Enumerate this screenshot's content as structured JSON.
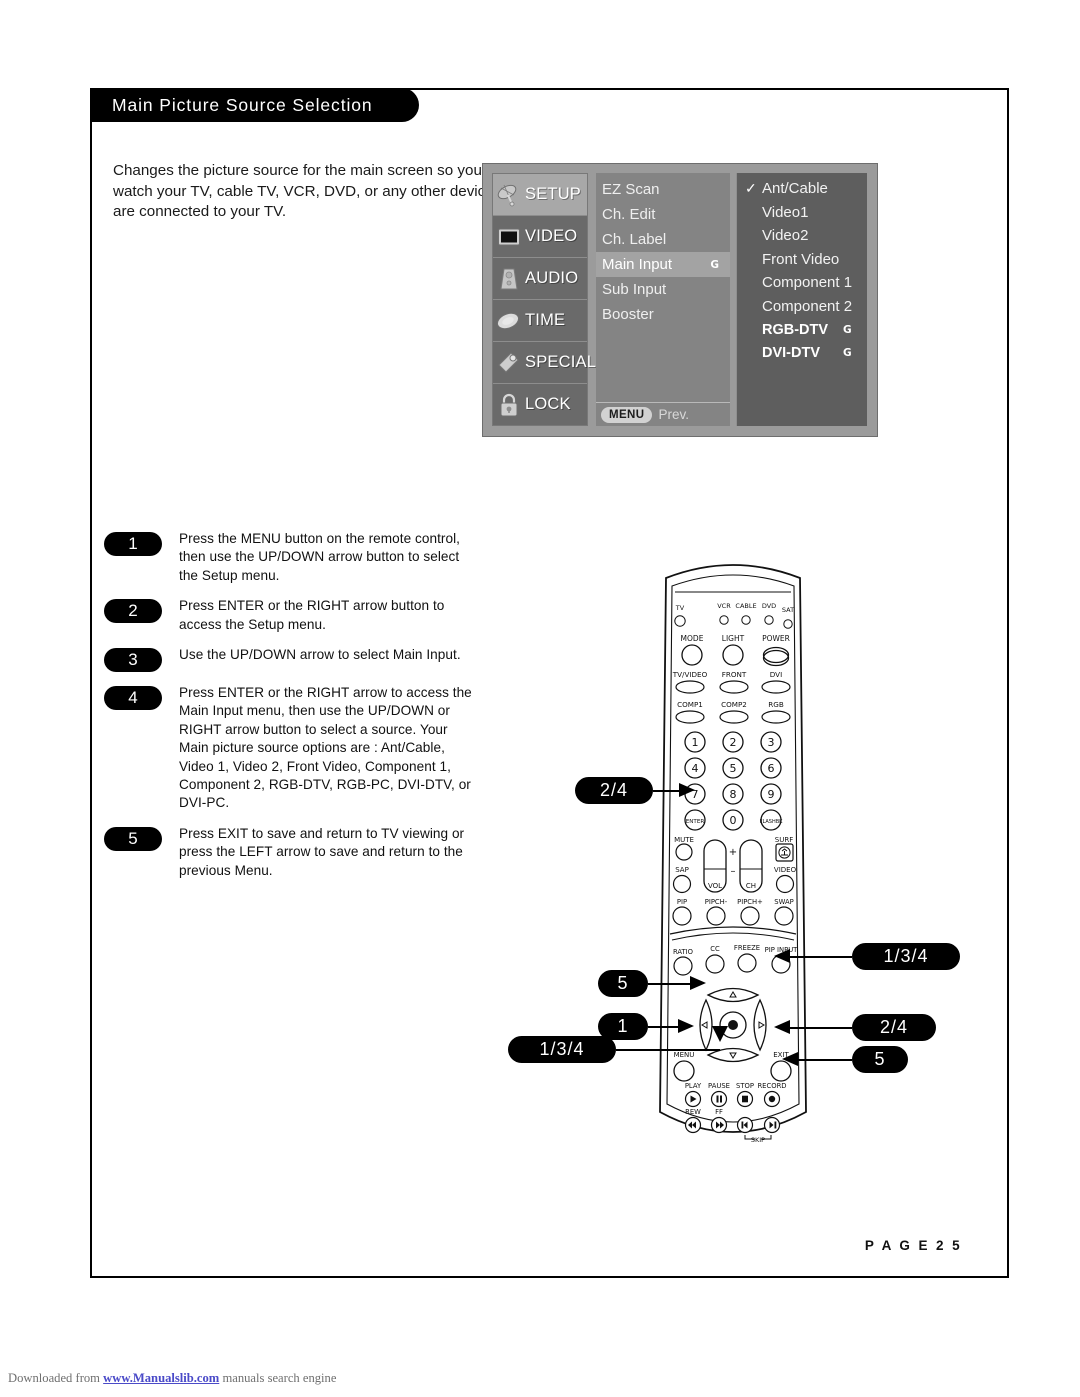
{
  "header": {
    "title": "Main Picture Source Selection"
  },
  "intro": {
    "text": "Changes the picture source for the main screen so you can watch your TV, cable TV, VCR, DVD, or any other devices that are connected to your TV."
  },
  "osd": {
    "categories": [
      {
        "label": "SETUP",
        "icon": "satellite-dish-icon",
        "active": true
      },
      {
        "label": "VIDEO",
        "icon": "tv-screen-icon",
        "active": false
      },
      {
        "label": "AUDIO",
        "icon": "speaker-icon",
        "active": false
      },
      {
        "label": "TIME",
        "icon": "clock-disc-icon",
        "active": false
      },
      {
        "label": "SPECIAL",
        "icon": "key-tag-icon",
        "active": false
      },
      {
        "label": "LOCK",
        "icon": "padlock-icon",
        "active": false
      }
    ],
    "setup_items": [
      {
        "label": "EZ Scan",
        "selected": false,
        "marker": ""
      },
      {
        "label": "Ch. Edit",
        "selected": false,
        "marker": ""
      },
      {
        "label": "Ch. Label",
        "selected": false,
        "marker": ""
      },
      {
        "label": "Main Input",
        "selected": true,
        "marker": "G"
      },
      {
        "label": "Sub Input",
        "selected": false,
        "marker": ""
      },
      {
        "label": "Booster",
        "selected": false,
        "marker": ""
      }
    ],
    "menu_button": "MENU",
    "menu_prev": "Prev.",
    "sources": [
      {
        "label": "Ant/Cable",
        "checked": true,
        "marker": "",
        "bold": false
      },
      {
        "label": "Video1",
        "checked": false,
        "marker": "",
        "bold": false
      },
      {
        "label": "Video2",
        "checked": false,
        "marker": "",
        "bold": false
      },
      {
        "label": "Front Video",
        "checked": false,
        "marker": "",
        "bold": false
      },
      {
        "label": "Component 1",
        "checked": false,
        "marker": "",
        "bold": false
      },
      {
        "label": "Component 2",
        "checked": false,
        "marker": "",
        "bold": false
      },
      {
        "label": "RGB-DTV",
        "checked": false,
        "marker": "G",
        "bold": true
      },
      {
        "label": "DVI-DTV",
        "checked": false,
        "marker": "G",
        "bold": true
      }
    ],
    "check_glyph": "✓"
  },
  "steps": [
    {
      "number": "1",
      "text": "Press the MENU button on the remote control, then use the UP/DOWN arrow button to select the Setup menu."
    },
    {
      "number": "2",
      "text": "Press ENTER or the RIGHT arrow button to access the Setup menu."
    },
    {
      "number": "3",
      "text": "Use the UP/DOWN arrow to select Main Input."
    },
    {
      "number": "4",
      "text": "Press ENTER or the RIGHT arrow to access the Main Input menu, then use the UP/DOWN or RIGHT arrow button to select a source. Your Main picture source options are : Ant/Cable, Video 1, Video 2, Front Video, Component 1, Component 2, RGB-DTV, RGB-PC, DVI-DTV, or DVI-PC."
    },
    {
      "number": "5",
      "text": "Press EXIT to save and return to TV viewing or press the LEFT arrow to save and return to the previous Menu."
    }
  ],
  "callouts": {
    "enter_left": "2/4",
    "dpad_left": "5",
    "menu_left": "1",
    "down_left": "1/3/4",
    "up_right": "1/3/4",
    "right_right": "2/4",
    "exit_right": "5"
  },
  "remote": {
    "device_leds": [
      "TV",
      "VCR",
      "CABLE",
      "DVD",
      "SAT"
    ],
    "row_mode": [
      "MODE",
      "LIGHT",
      "POWER"
    ],
    "row_input1": [
      "TV/VIDEO",
      "FRONT",
      "DVI"
    ],
    "row_input2": [
      "COMP1",
      "COMP2",
      "RGB"
    ],
    "keypad": [
      "1",
      "2",
      "3",
      "4",
      "5",
      "6",
      "7",
      "8",
      "9",
      "ENTER",
      "0",
      "FLASHBK"
    ],
    "row_mute": [
      "MUTE",
      "SURF"
    ],
    "row_sap": [
      "SAP",
      "VIDEO"
    ],
    "rocker_vol": "VOL",
    "rocker_ch": "CH",
    "rocker_plus": "+",
    "rocker_minus": "–",
    "row_pip": [
      "PIP",
      "PIPCH-",
      "PIPCH+",
      "SWAP"
    ],
    "row_ratio": [
      "RATIO",
      "CC",
      "FREEZE",
      "PIP INPUT"
    ],
    "row_menu_exit": [
      "MENU",
      "EXIT"
    ],
    "row_transport": [
      "PLAY",
      "PAUSE",
      "STOP",
      "RECORD"
    ],
    "row_transport2": [
      "REW",
      "FF"
    ],
    "skip_label": "SKIP"
  },
  "footer": {
    "page_label": "P A G E   2 5",
    "download_prefix": "Downloaded from ",
    "download_link": "www.Manualslib.com",
    "download_suffix": " manuals search engine"
  }
}
